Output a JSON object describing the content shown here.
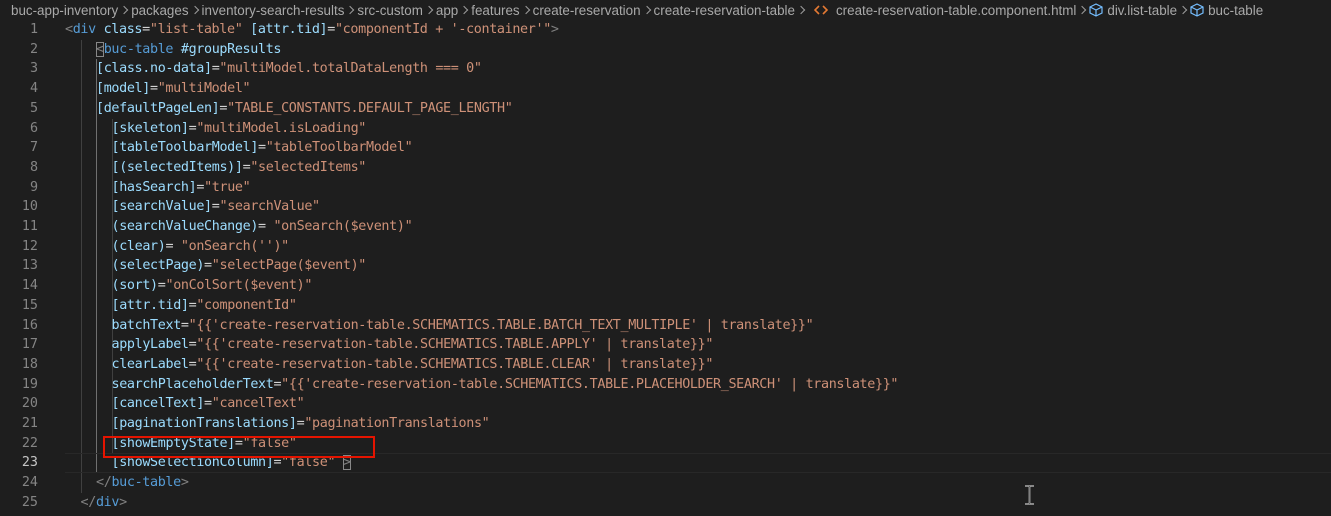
{
  "breadcrumb": {
    "items": [
      "buc-app-inventory",
      "packages",
      "inventory-search-results",
      "src-custom",
      "app",
      "features",
      "create-reservation",
      "create-reservation-table",
      "create-reservation-table.component.html",
      "div.list-table",
      "buc-table"
    ],
    "icons": {
      "8": "html-file-icon",
      "9": "symbol-element-icon",
      "10": "symbol-element-icon"
    }
  },
  "editor": {
    "language": "html",
    "active_line": 23,
    "highlight_line": 23,
    "lines": [
      {
        "n": "1",
        "text": "<div class=\"list-table\" [attr.tid]=\"componentId + '-container'\">"
      },
      {
        "n": "2",
        "text": "<buc-table #groupResults"
      },
      {
        "n": "3",
        "text": "[class.no-data]=\"multiModel.totalDataLength === 0\""
      },
      {
        "n": "4",
        "text": "[model]=\"multiModel\""
      },
      {
        "n": "5",
        "text": "[defaultPageLen]=\"TABLE_CONSTANTS.DEFAULT_PAGE_LENGTH\""
      },
      {
        "n": "6",
        "text": "[skeleton]=\"multiModel.isLoading\""
      },
      {
        "n": "7",
        "text": "[tableToolbarModel]=\"tableToolbarModel\""
      },
      {
        "n": "8",
        "text": "[(selectedItems)]=\"selectedItems\""
      },
      {
        "n": "9",
        "text": "[hasSearch]=\"true\""
      },
      {
        "n": "10",
        "text": "[searchValue]=\"searchValue\""
      },
      {
        "n": "11",
        "text": "(searchValueChange)= \"onSearch($event)\""
      },
      {
        "n": "12",
        "text": "(clear)= \"onSearch('')\""
      },
      {
        "n": "13",
        "text": "(selectPage)=\"selectPage($event)\""
      },
      {
        "n": "14",
        "text": "(sort)=\"onColSort($event)\""
      },
      {
        "n": "15",
        "text": "[attr.tid]=\"componentId\""
      },
      {
        "n": "16",
        "text": "batchText=\"{{'create-reservation-table.SCHEMATICS.TABLE.BATCH_TEXT_MULTIPLE' | translate}}\""
      },
      {
        "n": "17",
        "text": "applyLabel=\"{{'create-reservation-table.SCHEMATICS.TABLE.APPLY' | translate}}\""
      },
      {
        "n": "18",
        "text": "clearLabel=\"{{'create-reservation-table.SCHEMATICS.TABLE.CLEAR' | translate}}\""
      },
      {
        "n": "19",
        "text": "searchPlaceholderText=\"{{'create-reservation-table.SCHEMATICS.TABLE.PLACEHOLDER_SEARCH' | translate}}\""
      },
      {
        "n": "20",
        "text": "[cancelText]=\"cancelText\""
      },
      {
        "n": "21",
        "text": "[paginationTranslations]=\"paginationTranslations\""
      },
      {
        "n": "22",
        "text": "[showEmptyState]=\"false\""
      },
      {
        "n": "23",
        "text": "[showSelectionColumn]=\"false\" >"
      },
      {
        "n": "24",
        "text": "</buc-table>"
      },
      {
        "n": "25",
        "text": "</div>"
      }
    ]
  },
  "colors": {
    "background": "#1e1e1e",
    "tag": "#569cd6",
    "punctuation": "#808080",
    "attribute": "#9cdcfe",
    "string": "#ce9178",
    "line_number": "#858585",
    "annotation_box": "#e51400"
  }
}
